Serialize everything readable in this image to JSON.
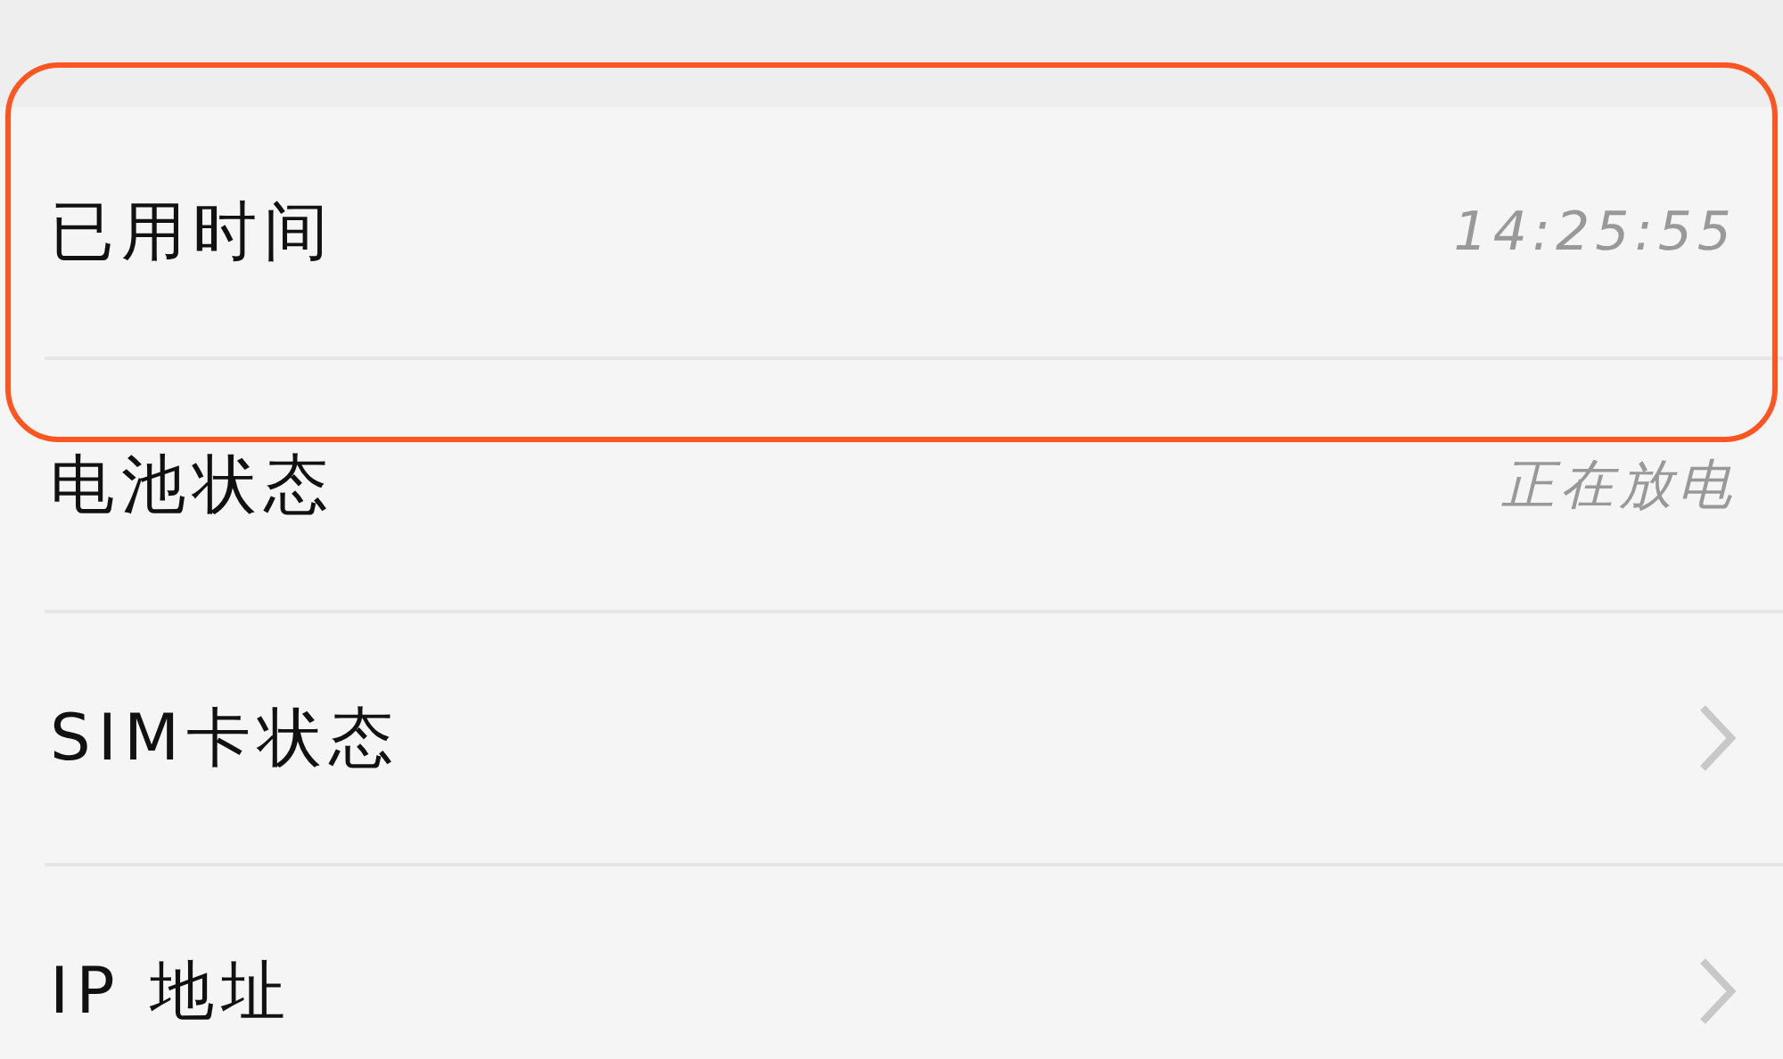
{
  "rows": [
    {
      "label": "已用时间",
      "kind": "value",
      "value": "14:25:55",
      "highlighted": true
    },
    {
      "label": "电池状态",
      "kind": "value",
      "value": "正在放电",
      "highlighted": false
    },
    {
      "label": "SIM卡状态",
      "kind": "link",
      "highlighted": false
    },
    {
      "label": "IP 地址",
      "kind": "link",
      "highlighted": false
    }
  ]
}
